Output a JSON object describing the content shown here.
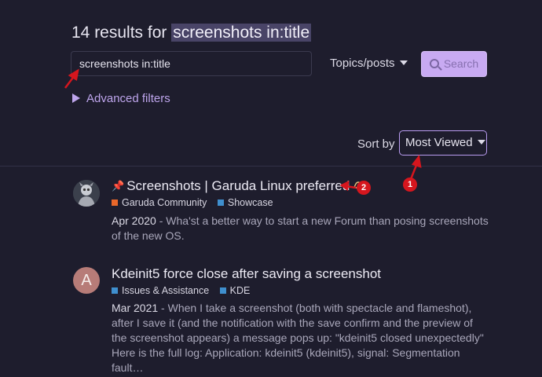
{
  "heading": {
    "count_text": "14 results for",
    "query_highlight": "screenshots in:title"
  },
  "search": {
    "value": "screenshots in:title",
    "type_select": "Topics/posts",
    "button_label": "Search"
  },
  "advanced_filters": "Advanced filters",
  "sort": {
    "label": "Sort by",
    "selected": "Most Viewed"
  },
  "results": [
    {
      "title": "Screenshots | Garuda Linux preferred",
      "pinned": true,
      "categories": [
        {
          "name": "Garuda Community",
          "color": "#e9672a"
        },
        {
          "name": "Showcase",
          "color": "#3f8fce"
        }
      ],
      "date": "Apr 2020",
      "separator": "-",
      "excerpt": "Wha'st a better way to start a new Forum than posing screenshots of the new OS."
    },
    {
      "title": "Kdeinit5 force close after saving a screenshot",
      "avatar_letter": "A",
      "categories": [
        {
          "name": "Issues & Assistance",
          "color": "#3f8fce"
        },
        {
          "name": "KDE",
          "color": "#3f8fce"
        }
      ],
      "date": "Mar 2021",
      "separator": "-",
      "excerpt": "When I take a screenshot (both with spectacle and flameshot), after I save it (and the notification with the save confirm and the preview of the screenshot appears) a message pops up: \"kdeinit5 closed unexpectedly\" Here is the full log: Application: kdeinit5 (kdeinit5), signal: Segmentation fault…"
    }
  ],
  "annotations": {
    "badge_1": "1",
    "badge_2": "2",
    "color": "#d5161e"
  }
}
